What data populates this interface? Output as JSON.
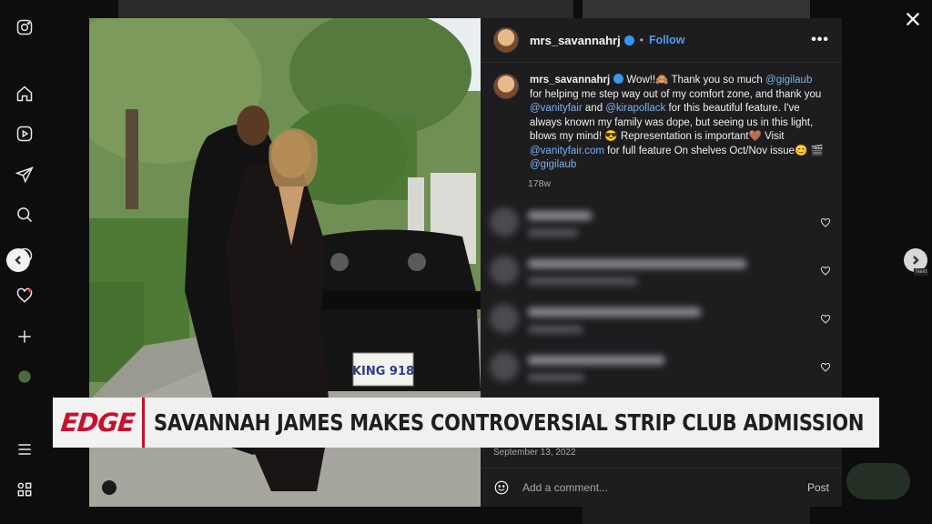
{
  "post": {
    "username": "mrs_savannahrj",
    "follow_label": "Follow",
    "more_label": "•••",
    "caption_parts": {
      "p1": " Wow!!🙈 Thank you so much ",
      "m1": "@gigilaub",
      "p2": " for helping me step way out of my comfort zone, and thank you ",
      "m2": "@vanityfair",
      "p3": " and ",
      "m3": "@kirapollack",
      "p4": " for this beautiful feature. I've always known my family was dope, but seeing us in this light, blows my mind! 😎 Representation is important🤎 Visit ",
      "m4": "@vanityfair.com",
      "p5": " for full feature On shelves Oct/Nov issue😊 🎬 ",
      "m5": "@gigilaub"
    },
    "time_ago": "178w",
    "date": "September 13, 2022",
    "comment_placeholder": "Add a comment...",
    "post_label": "Post",
    "license_plate": "KING 918"
  },
  "comments": [
    {
      "line1_w": 70,
      "line2_w": 55
    },
    {
      "line1_w": 240,
      "line2_w": 120
    },
    {
      "line1_w": 190,
      "line2_w": 60
    },
    {
      "line1_w": 150,
      "line2_w": 62
    }
  ],
  "banner": {
    "logo": "EDGE",
    "headline": "SAVANNAH JAMES MAKES CONTROVERSIAL STRIP CLUB ADMISSION"
  },
  "nav": {
    "next_tooltip": "Next"
  },
  "sidebar_icons": [
    "instagram-icon",
    "home-icon",
    "reels-icon",
    "messages-icon",
    "search-icon",
    "explore-icon",
    "notifications-icon",
    "create-icon",
    "profile-icon",
    "menu-icon",
    "apps-icon"
  ],
  "colors": {
    "link": "#4a9ef8",
    "mention": "#7ab1f2",
    "banner_red": "#c8102e",
    "panel_bg": "#1d1d1f"
  }
}
